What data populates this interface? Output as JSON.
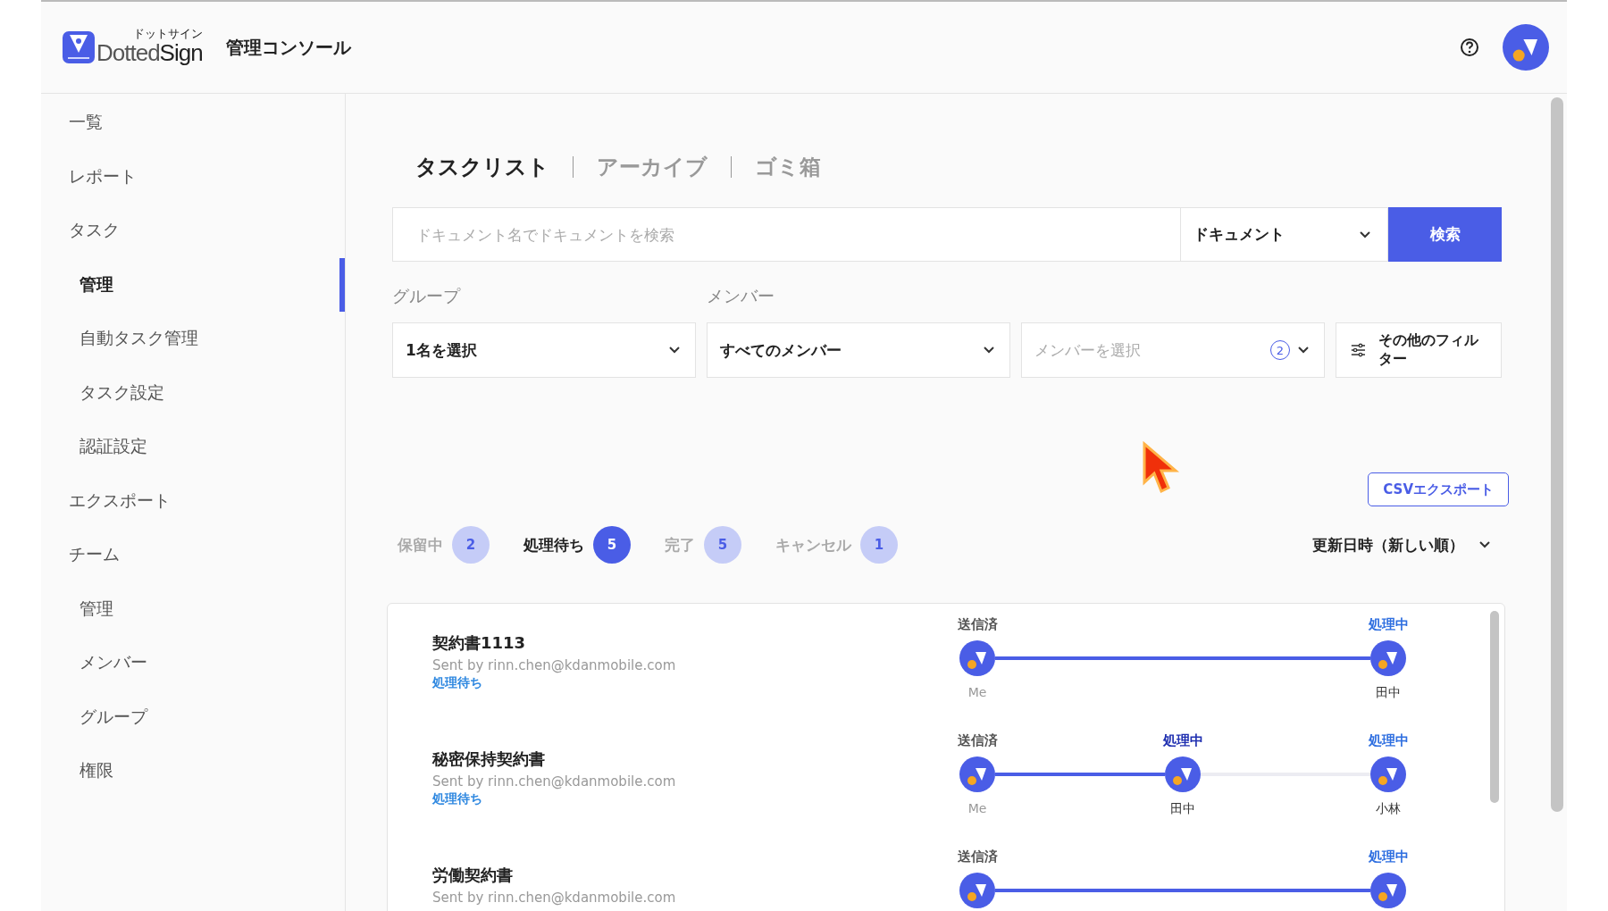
{
  "header": {
    "logo_kana": "ドットサイン",
    "logo_word_1": "Dotted",
    "logo_word_2": "Sign",
    "title": "管理コンソール"
  },
  "sidebar": {
    "items": [
      {
        "label": "一覧",
        "selected": false
      },
      {
        "label": "レポート",
        "selected": false
      },
      {
        "label": "タスク",
        "selected": false,
        "children": [
          {
            "label": "管理",
            "selected": true
          },
          {
            "label": "自動タスク管理",
            "selected": false
          },
          {
            "label": "タスク設定",
            "selected": false
          },
          {
            "label": "認証設定",
            "selected": false
          }
        ]
      },
      {
        "label": "エクスポート",
        "selected": false
      },
      {
        "label": "チーム",
        "selected": false,
        "children": [
          {
            "label": "管理",
            "selected": false
          },
          {
            "label": "メンバー",
            "selected": false
          },
          {
            "label": "グループ",
            "selected": false
          },
          {
            "label": "権限",
            "selected": false
          }
        ]
      }
    ]
  },
  "view_tabs": [
    {
      "label": "タスクリスト",
      "selected": true
    },
    {
      "label": "アーカイブ",
      "selected": false
    },
    {
      "label": "ゴミ箱",
      "selected": false
    }
  ],
  "search": {
    "placeholder": "ドキュメント名でドキュメントを検索",
    "scope": "ドキュメント",
    "button": "検索"
  },
  "filters": {
    "group_label": "グループ",
    "group_value": "1名を選択",
    "member_label": "メンバー",
    "member_scope": "すべてのメンバー",
    "member_placeholder": "メンバーを選択",
    "member_count": "2",
    "more": "その他のフィルター"
  },
  "export_button": "CSVエクスポート",
  "status_tabs": [
    {
      "label": "保留中",
      "count": "2",
      "selected": false
    },
    {
      "label": "処理待ち",
      "count": "5",
      "selected": true
    },
    {
      "label": "完了",
      "count": "5",
      "selected": false
    },
    {
      "label": "キャンセル",
      "count": "1",
      "selected": false
    }
  ],
  "sort": "更新日時（新しい順）",
  "tasks": [
    {
      "title": "契約書1113",
      "sender": "Sent by rinn.chen@kdanmobile.com",
      "status": "処理待ち",
      "steps": [
        {
          "label": "送信済",
          "kind": "sent",
          "name": "Me",
          "linked": true
        },
        {
          "label": "処理中",
          "kind": "processing",
          "name": "田中"
        }
      ]
    },
    {
      "title": "秘密保持契約書",
      "sender": "Sent by rinn.chen@kdanmobile.com",
      "status": "処理待ち",
      "steps": [
        {
          "label": "送信済",
          "kind": "sent",
          "name": "Me",
          "linked": true
        },
        {
          "label": "処理中",
          "kind": "current",
          "name": "田中",
          "linked": false
        },
        {
          "label": "処理中",
          "kind": "processing",
          "name": "小林"
        }
      ]
    },
    {
      "title": "労働契約書",
      "sender": "Sent by rinn.chen@kdanmobile.com",
      "steps": [
        {
          "label": "送信済",
          "kind": "sent",
          "linked": true
        },
        {
          "label": "処理中",
          "kind": "processing"
        }
      ]
    }
  ]
}
